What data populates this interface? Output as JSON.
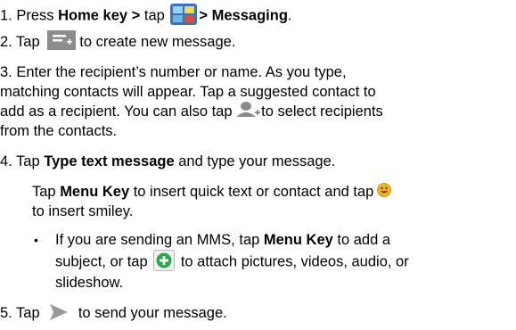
{
  "steps": {
    "s1": {
      "num": "1. Press ",
      "home_key": "Home key >",
      "tap": " tap ",
      "messaging": "> Messaging",
      "period": ".",
      "icon": "apps-grid-icon"
    },
    "s2": {
      "num": "2. Tap ",
      "text": "to create new message.",
      "icon": "new-message-icon"
    },
    "s3": {
      "line1": "3. Enter the recipient’s number or name. As you type,",
      "line2": "matching contacts will appear. Tap a suggested contact to",
      "line3a": "add as a recipient. You can also tap ",
      "line3b": "to select recipients",
      "line4": "from the contacts.",
      "icon": "add-contact-icon"
    },
    "s4": {
      "num": "4. Tap ",
      "bold": "Type text message",
      "rest": " and type your message.",
      "sub1a": "Tap ",
      "sub1bold": "Menu Key",
      "sub1b": " to insert quick text or contact and tap",
      "sub2": "to insert smiley.",
      "smiley_icon": "smiley-icon",
      "bullet": "•",
      "b1a": "If you are sending an MMS, tap ",
      "b1bold": "Menu Key",
      "b1b": " to add a",
      "b2a": "subject, or tap ",
      "b2b": " to attach pictures, videos, audio, or",
      "b3": "slideshow.",
      "attach_icon": "attach-plus-icon"
    },
    "s5": {
      "num": "5.  Tap ",
      "text": " to send your message.",
      "icon": "send-arrow-icon"
    }
  },
  "colors": {
    "text": "#000000",
    "attach_green": "#2fa84f",
    "smiley_yellow": "#f2b51a",
    "icon_grey": "#8a8a8a"
  }
}
